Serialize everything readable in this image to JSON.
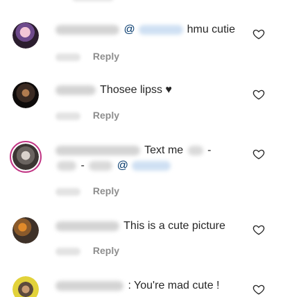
{
  "comments": [
    {
      "text_before": "@",
      "text_after": "hmu cutie",
      "reply_label": "Reply",
      "avatar_colors": [
        "#f3c6d6",
        "#6e4a8c",
        "#2b1d2e"
      ]
    },
    {
      "text": "Thosee lipss ♥",
      "reply_label": "Reply",
      "avatar_colors": [
        "#3a2a22",
        "#0e0b0a",
        "#b07b4f"
      ]
    },
    {
      "line1": "Text me",
      "line1_tail": "-",
      "line2_a": "-",
      "line2_b": "@",
      "reply_label": "Reply",
      "avatar_colors": [
        "#d9d2cc",
        "#6a6460",
        "#3b3633"
      ],
      "ring_color": "#c13584"
    },
    {
      "text": "This is a cute picture",
      "reply_label": "Reply",
      "avatar_colors": [
        "#e08a2a",
        "#3e3128",
        "#8a5a2b"
      ]
    },
    {
      "text": ": You're mad cute !",
      "avatar_colors": [
        "#e2d23a",
        "#5c4a3c",
        "#c89b73"
      ]
    }
  ],
  "icons": {
    "like": "heart-outline-icon"
  },
  "colors": {
    "text": "#262626",
    "secondary": "#8e8e8e",
    "mention": "#00376b",
    "story_ring": "#c13584"
  }
}
